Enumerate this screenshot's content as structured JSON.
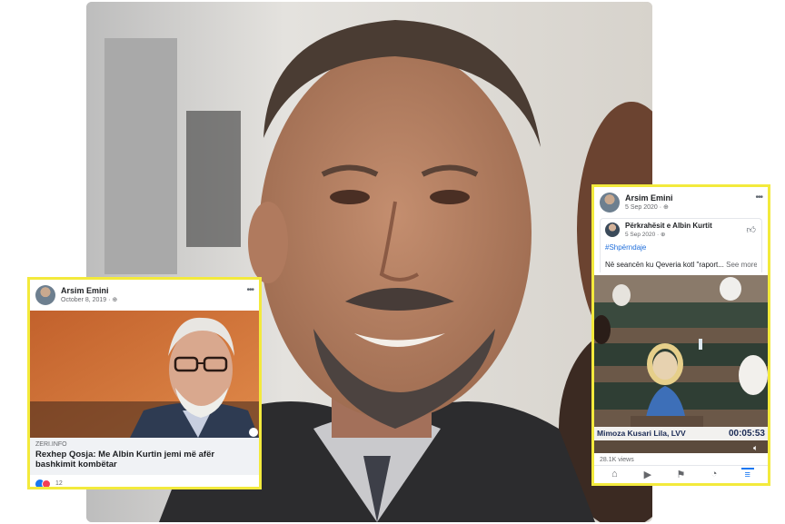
{
  "left_post": {
    "author": "Arsim Emini",
    "date": "October 8, 2019 · ",
    "globe_icon": "globe-icon",
    "more_icon": "more-options-icon",
    "link": {
      "domain": "ZERI.INFO",
      "title": "Rexhep Qosja: Me Albin Kurtin jemi më afër bashkimit kombëtar"
    },
    "reactions": {
      "icons": [
        "like-icon",
        "love-icon"
      ],
      "count": "12"
    }
  },
  "right_post": {
    "author": "Arsim Emini",
    "date": "5 Sep 2020 · ",
    "more_icon": "more-options-icon",
    "shared_post": {
      "page_name": "Përkrahësit e Albin Kurtit",
      "date": "5 Sep 2020 · ",
      "hashtag": "#Shpërndaje",
      "text": "Në seancën ku Qeveria kotl \"raport...",
      "see_more": "See more"
    },
    "video": {
      "lower_third_name": "Mimoza Kusari Lila, LVV",
      "timestamp": "00:05:53",
      "speaker_icon": "volume-icon"
    },
    "views": "28.1K views",
    "nav": [
      "home-icon",
      "video-icon",
      "flag-icon",
      "bell-icon",
      "menu-icon"
    ]
  },
  "colors": {
    "highlight_border": "#f3ea3c",
    "facebook_blue": "#1877f2",
    "caption_text": "#1a2a55"
  }
}
